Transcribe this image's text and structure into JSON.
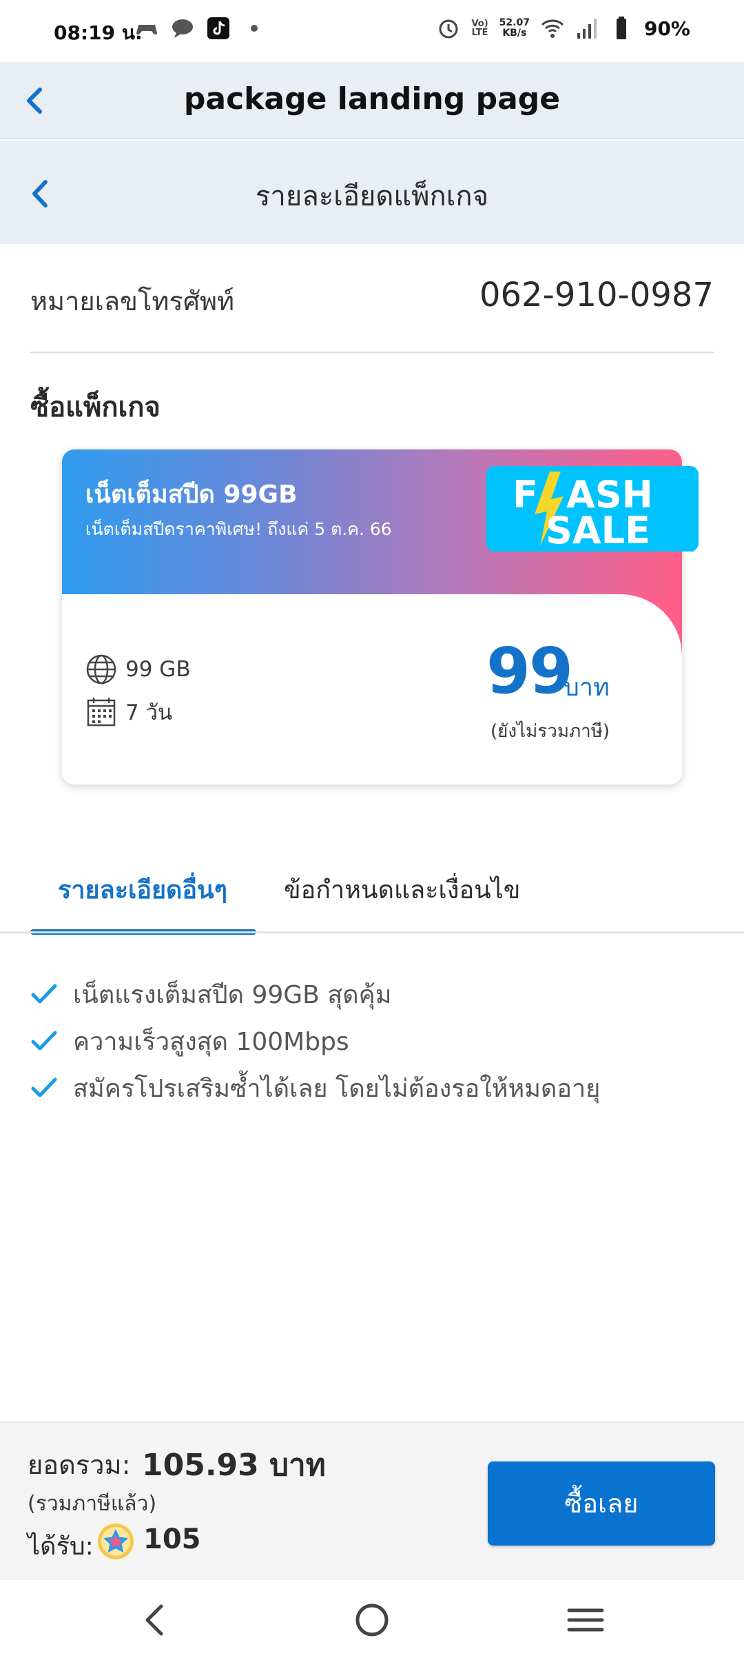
{
  "status_bar": {
    "time": "08:19 น.",
    "net_speed_value": "52.07",
    "net_speed_unit": "KB/s",
    "volte_top": "Vo)",
    "volte_bottom": "LTE",
    "battery_percent": "90%"
  },
  "app_bar": {
    "title": "package landing page"
  },
  "sub_bar": {
    "title": "รายละเอียดแพ็กเกจ"
  },
  "phone": {
    "label": "หมายเลขโทรศัพท์",
    "value": "062-910-0987"
  },
  "section": {
    "title": "ซื้อแพ็กเกจ"
  },
  "package": {
    "name": "เน็ตเต็มสปีด 99GB",
    "description": "เน็ตเต็มสปีดราคาพิเศษ! ถึงแค่ 5 ต.ค. 66",
    "badge_line1_a": "F",
    "badge_line1_b": "ASH",
    "badge_line2": "SALE",
    "data_amount": "99 GB",
    "validity": "7 วัน",
    "price": "99",
    "price_unit": "บาท",
    "price_note": "(ยังไม่รวมภาษี)"
  },
  "tabs": {
    "active": "รายละเอียดอื่นๆ",
    "inactive": "ข้อกำหนดและเงื่อนไข"
  },
  "features": [
    "เน็ตแรงเต็มสปีด 99GB สุดคุ้ม",
    "ความเร็วสูงสุด 100Mbps",
    "สมัครโปรเสริมซ้ำได้เลย โดยไม่ต้องรอให้หมดอายุ"
  ],
  "summary": {
    "total_label": "ยอดรวม:",
    "total_value": "105.93 บาท",
    "tax_note": "(รวมภาษีแล้ว)",
    "get_label": "ได้รับ:",
    "points": "105",
    "buy_label": "ซื้อเลย"
  },
  "colors": {
    "accent_blue": "#1472c9",
    "button_blue": "#0a72cf",
    "header_bg": "#e8eef3",
    "flash_bg": "#00c2ff",
    "flash_bolt": "#f5d62a"
  }
}
